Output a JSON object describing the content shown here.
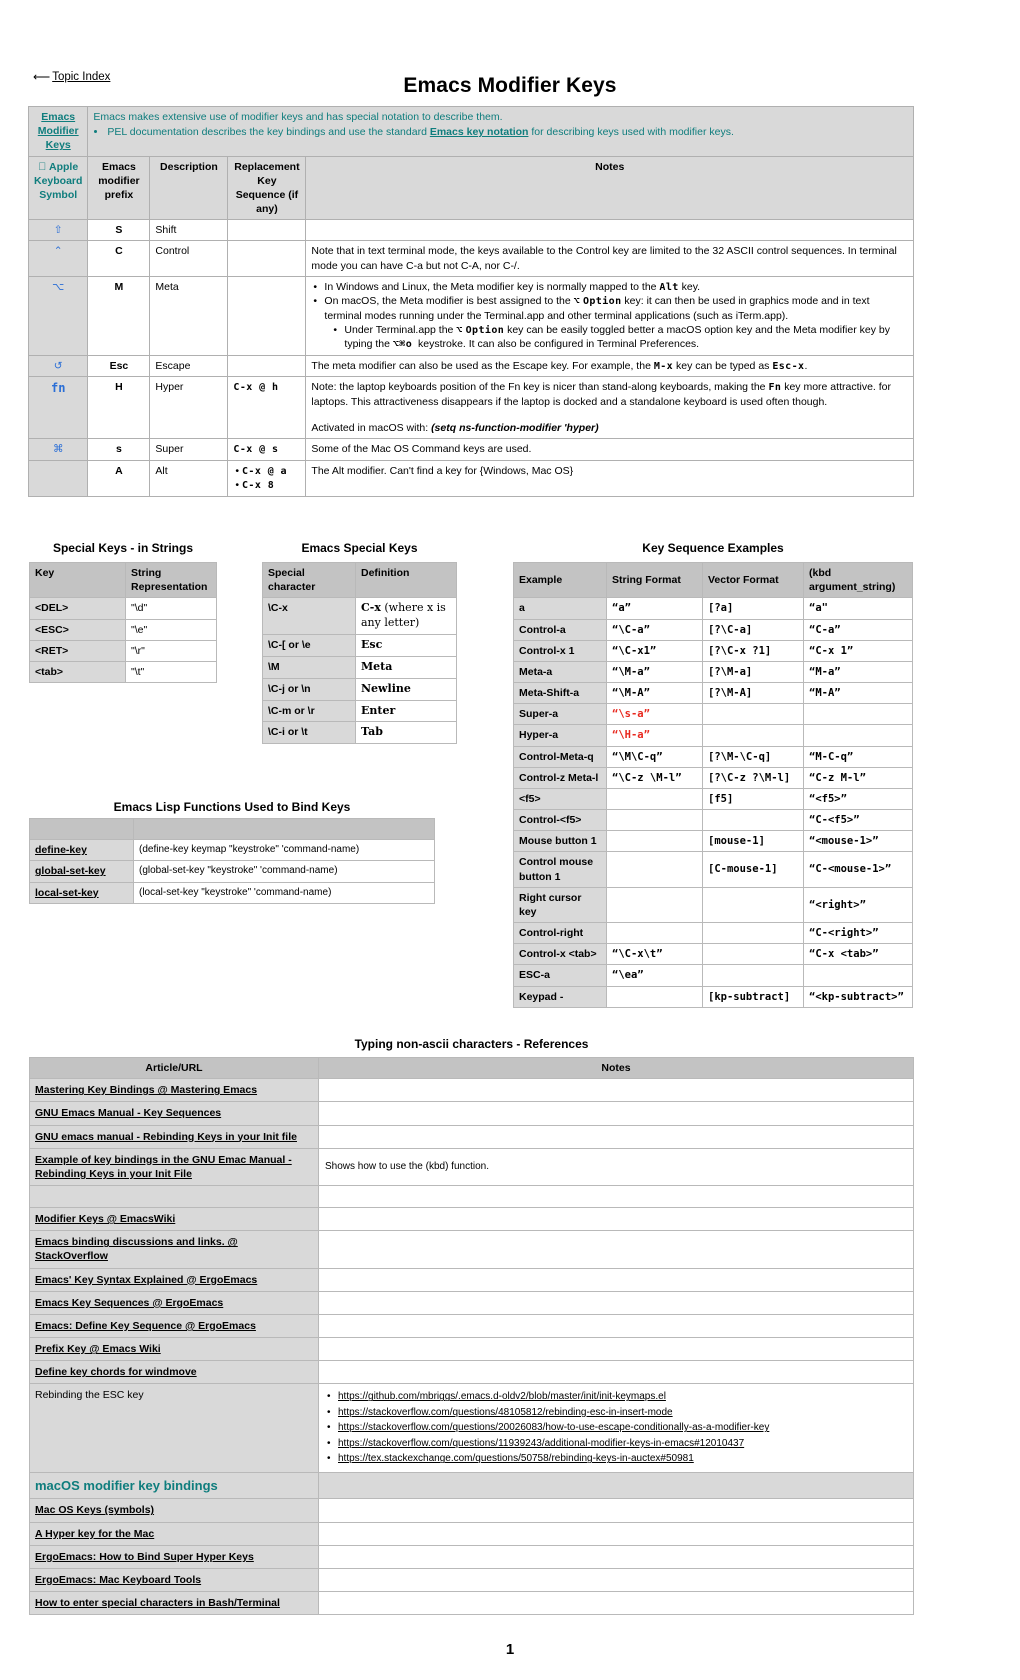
{
  "topbar": {
    "link_label": "Topic Index",
    "arrow_icon": "back-arrow-icon"
  },
  "doc_title": "Emacs Modifier Keys",
  "page_number": "1",
  "colors": {
    "teal": "#0f7d7d",
    "blue": "#2a6ed6",
    "red": "#e8281e",
    "header_gray": "#c3c3c3",
    "cell_gray": "#d9d9d9"
  },
  "modifier_table": {
    "banner_title": "Emacs Modifier Keys",
    "banner_line1": "Emacs makes extensive use of modifier keys and has special notation to describe them.",
    "banner_bullet1_pre": "PEL documentation describes the key bindings and use the standard ",
    "banner_bullet1_link": "Emacs key notation",
    "banner_bullet1_post": " for describing keys used with modifier keys.",
    "headers": {
      "apple": "Apple Keyboard Symbol",
      "apple_icon": "apple-logo-icon",
      "prefix": "Emacs modifier prefix",
      "description": "Description",
      "replacement": "Replacement Key Sequence (if any)",
      "notes": "Notes"
    },
    "rows": [
      {
        "symbol": "⇧",
        "symbol_name": "shift-key-icon",
        "prefix": "S",
        "description": "Shift",
        "replacement": "",
        "notes": ""
      },
      {
        "symbol": "⌃",
        "symbol_name": "control-key-icon",
        "prefix": "C",
        "description": "Control",
        "replacement": "",
        "notes": "Note that in text terminal mode, the keys available to the Control key are limited to the 32 ASCII control sequences.   In terminal mode you can have C-a but not C-A, nor C-/."
      },
      {
        "symbol": "⌥",
        "symbol_name": "option-key-icon",
        "prefix": "M",
        "description": "Meta",
        "replacement": "",
        "notes_bullets": [
          {
            "pre": "In Windows and Linux, the Meta modifier key is normally mapped to the ",
            "code": "Alt",
            "post": " key."
          },
          {
            "pre": "On macOS, the Meta modifier is best assigned to the ",
            "sym": "⌥",
            "code": "Option",
            "post": " key: it can then be used in graphics mode and in text terminal modes running under the Terminal.app and other terminal applications (such as iTerm.app)."
          }
        ],
        "notes_subbullet": {
          "pre": "Under Terminal.app the ",
          "sym": "⌥",
          "code": "Option",
          "mid": " key can be easily toggled better a macOS option key and the Meta modifier key by typing the ",
          "code2": "⌥⌘o",
          "post": " keystroke. It can also be configured in Terminal Preferences."
        }
      },
      {
        "symbol": "↺",
        "symbol_name": "escape-key-icon",
        "prefix": "Esc",
        "description": "Escape",
        "replacement": "",
        "notes_pre": "The meta modifier can also be used as the Escape key.  For example, the ",
        "notes_code1": "M-x",
        "notes_mid": " key can be typed as ",
        "notes_code2": "Esc-x",
        "notes_post": "."
      },
      {
        "symbol": "fn",
        "symbol_name": "fn-key-icon",
        "prefix": "H",
        "description": "Hyper",
        "replacement": "C-x @ h",
        "notes_pre": "Note: the laptop keyboards position of the Fn key is nicer than stand-along keyboards, making the ",
        "notes_code1": "Fn",
        "notes_post": " key more attractive. for laptops.  This attractiveness disappears if the laptop is docked and a standalone keyboard is used often though.",
        "notes_line2_pre": "Activated in macOS with:  ",
        "notes_line2_em": "(setq ns-function-modifier 'hyper)"
      },
      {
        "symbol": "⌘",
        "symbol_name": "command-key-icon",
        "prefix": "s",
        "description": "Super",
        "replacement": "C-x @ s",
        "notes": "Some of the Mac OS Command keys are used."
      },
      {
        "symbol": "",
        "symbol_name": "no-symbol",
        "prefix": "A",
        "description": "Alt",
        "replacement_list": [
          "C-x @ a",
          "C-x 8"
        ],
        "notes": "The Alt modifier.  Can't find a key for {Windows, Mac OS}"
      }
    ]
  },
  "special_keys_strings": {
    "title": "Special Keys - in Strings",
    "headers": [
      "Key",
      "String Representation"
    ],
    "rows": [
      [
        "<DEL>",
        "\"\\d\""
      ],
      [
        "<ESC>",
        "\"\\e\""
      ],
      [
        "<RET>",
        "\"\\r\""
      ],
      [
        "<tab>",
        "\"\\t\""
      ]
    ]
  },
  "emacs_special_keys": {
    "title": "Emacs Special Keys",
    "headers": [
      "Special character",
      "Definition"
    ],
    "rows": [
      {
        "char": "\\C-x",
        "def_bold": "C-x",
        "def_rest": " (where x is any letter)"
      },
      {
        "char": "\\C-[ or \\e",
        "def_bold": "Esc",
        "def_rest": ""
      },
      {
        "char": "\\M",
        "def_bold": "Meta",
        "def_rest": ""
      },
      {
        "char": "\\C-j or \\n",
        "def_bold": "Newline",
        "def_rest": ""
      },
      {
        "char": "\\C-m or \\r",
        "def_bold": "Enter",
        "def_rest": ""
      },
      {
        "char": "\\C-i or \\t",
        "def_bold": "Tab",
        "def_rest": ""
      }
    ]
  },
  "key_sequence_examples": {
    "title": "Key Sequence Examples",
    "headers": [
      "Example",
      "String Format",
      "Vector Format",
      "(kbd argument_string)"
    ],
    "rows": [
      {
        "example": "a",
        "string": "“a”",
        "vector": "[?a]",
        "kbd": "“a\"",
        "red": false
      },
      {
        "example": "Control-a",
        "string": "“\\C-a”",
        "vector": "[?\\C-a]",
        "kbd": "“C-a”",
        "red": false
      },
      {
        "example": "Control-x 1",
        "string": "“\\C-x1”",
        "vector": "[?\\C-x ?1]",
        "kbd": "“C-x 1”",
        "red": false
      },
      {
        "example": "Meta-a",
        "string": "“\\M-a”",
        "vector": "[?\\M-a]",
        "kbd": "“M-a”",
        "red": false
      },
      {
        "example": "Meta-Shift-a",
        "string": "“\\M-A”",
        "vector": "[?\\M-A]",
        "kbd": "“M-A”",
        "red": false
      },
      {
        "example": "Super-a",
        "string": "“\\s-a”",
        "vector": "",
        "kbd": "",
        "red": true
      },
      {
        "example": "Hyper-a",
        "string": "“\\H-a”",
        "vector": "",
        "kbd": "",
        "red": true
      },
      {
        "example": "Control-Meta-q",
        "string": "“\\M\\C-q”",
        "vector": "[?\\M-\\C-q]",
        "kbd": "“M-C-q”",
        "red": false
      },
      {
        "example": "Control-z Meta-l",
        "string": "“\\C-z \\M-l”",
        "vector": "[?\\C-z ?\\M-l]",
        "kbd": "“C-z M-l”",
        "red": false
      },
      {
        "example": "<f5>",
        "string": "",
        "vector": "[f5]",
        "kbd": "“<f5>”",
        "red": false
      },
      {
        "example": "Control-<f5>",
        "string": "",
        "vector": "",
        "kbd": "“C-<f5>”",
        "red": false
      },
      {
        "example": "Mouse button 1",
        "string": "",
        "vector": "[mouse-1]",
        "kbd": "“<mouse-1>”",
        "red": false
      },
      {
        "example": "Control mouse button 1",
        "string": "",
        "vector": "[C-mouse-1]",
        "kbd": "“C-<mouse-1>”",
        "red": false
      },
      {
        "example": "Right cursor key",
        "string": "",
        "vector": "",
        "kbd": "“<right>”",
        "red": false
      },
      {
        "example": "Control-right",
        "string": "",
        "vector": "",
        "kbd": "“C-<right>”",
        "red": false
      },
      {
        "example": "Control-x <tab>",
        "string": "“\\C-x\\t”",
        "vector": "",
        "kbd": "“C-x <tab>”",
        "red": false
      },
      {
        "example": "ESC-a",
        "string": "“\\ea”",
        "vector": "",
        "kbd": "",
        "red": false
      },
      {
        "example": "Keypad -",
        "string": "",
        "vector": "[kp-subtract]",
        "kbd": "“<kp-subtract>”",
        "red": false
      }
    ]
  },
  "lisp_functions": {
    "title": "Emacs Lisp Functions Used to Bind Keys",
    "rows": [
      {
        "fn": "define-key",
        "sig": "(define-key keymap \"keystroke\" 'command-name)"
      },
      {
        "fn": "global-set-key",
        "sig": "(global-set-key \"keystroke\" 'command-name)"
      },
      {
        "fn": "local-set-key",
        "sig": "(local-set-key \"keystroke\" 'command-name)"
      }
    ]
  },
  "references": {
    "title": "Typing non-ascii characters - References",
    "headers": [
      "Article/URL",
      "Notes"
    ],
    "rows": [
      {
        "article": "Mastering Key Bindings @ Mastering Emacs",
        "notes": "",
        "link": true
      },
      {
        "article": "GNU Emacs Manual - Key Sequences",
        "notes": "",
        "link": true
      },
      {
        "article": "GNU emacs manual  - Rebinding Keys in your Init file",
        "notes": "",
        "link": true
      },
      {
        "article": "Example of key bindings in the GNU Emac Manual - Rebinding Keys in your Init File",
        "notes": "Shows how to use the (kbd) function.",
        "link": true
      },
      {
        "article": "",
        "notes": "",
        "link": false
      },
      {
        "article": "Modifier Keys @ EmacsWiki",
        "notes": "",
        "link": true
      },
      {
        "article": "Emacs binding discussions and links. @ StackOverflow",
        "notes": "",
        "link": true
      },
      {
        "article": "Emacs' Key Syntax Explained @ ErgoEmacs",
        "notes": "",
        "link": true
      },
      {
        "article": "Emacs Key Sequences @ ErgoEmacs",
        "notes": "",
        "link": true
      },
      {
        "article": "Emacs: Define Key Sequence @ ErgoEmacs",
        "notes": "",
        "link": true
      },
      {
        "article": "Prefix Key @ Emacs Wiki",
        "notes": "",
        "link": true
      },
      {
        "article": "Define key chords for windmove",
        "notes": "",
        "link": true
      },
      {
        "article": "Rebinding the ESC key",
        "link": false,
        "notes_links": [
          "https://github.com/mbriggs/.emacs.d-oldv2/blob/master/init/init-keymaps.el",
          "https://stackoverflow.com/questions/48105812/rebinding-esc-in-insert-mode",
          "https://stackoverflow.com/questions/20026083/how-to-use-escape-conditionally-as-a-modifier-key",
          "https://stackoverflow.com/questions/11939243/additional-modifier-keys-in-emacs#12010437",
          "https://tex.stackexchange.com/questions/50758/rebinding-keys-in-auctex#50981"
        ]
      },
      {
        "article": "macOS modifier key bindings",
        "notes": "",
        "section": true
      },
      {
        "article": "Mac OS Keys (symbols)",
        "notes": "",
        "link": true
      },
      {
        "article": "A Hyper key for the Mac",
        "notes": "",
        "link": true
      },
      {
        "article": "ErgoEmacs: How to Bind Super Hyper Keys",
        "notes": "",
        "link": true
      },
      {
        "article": "ErgoEmacs: Mac Keyboard Tools",
        "notes": "",
        "link": true
      },
      {
        "article": "How to enter special characters in Bash/Terminal",
        "notes": "",
        "link": true
      }
    ]
  }
}
